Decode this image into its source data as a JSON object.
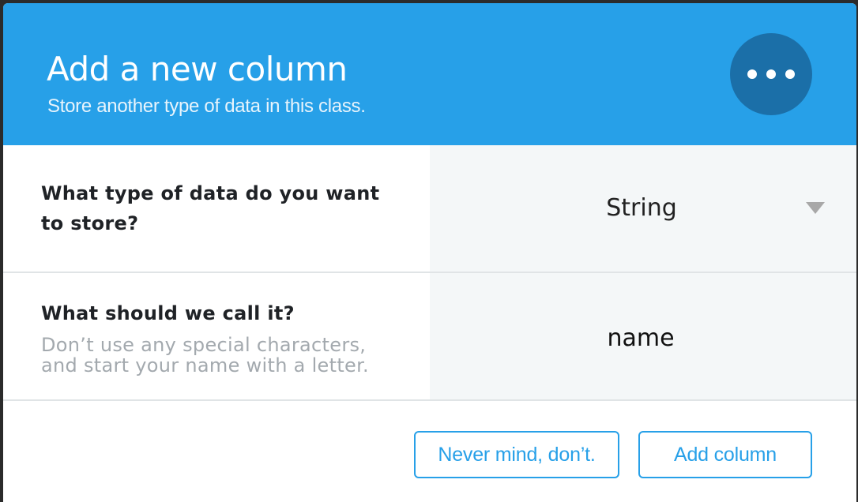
{
  "dialog": {
    "title": "Add a new column",
    "subtitle": "Store another type of data in this class.",
    "icon": "more-dots-icon",
    "accent_color": "#27a0e8"
  },
  "rows": {
    "type": {
      "label": "What type of data do you want to store?",
      "selected_value": "String",
      "caret_icon": "triangle-down-icon"
    },
    "name": {
      "label": "What should we call it?",
      "hint": "Don’t use any special characters, and start your name with a letter.",
      "value": "name"
    }
  },
  "footer": {
    "cancel_label": "Never mind, don’t.",
    "submit_label": "Add column"
  }
}
